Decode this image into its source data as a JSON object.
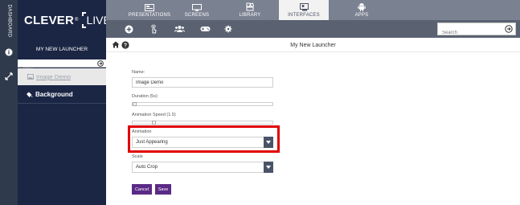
{
  "dashboard": {
    "label": "DASHBOARD"
  },
  "logo": {
    "name": "CLEVER",
    "registered": "®",
    "live": "LIVE"
  },
  "topnav": {
    "tabs": [
      {
        "label": "PRESENTATIONS",
        "icon": "presentation-icon"
      },
      {
        "label": "SCREENS",
        "icon": "monitor-icon"
      },
      {
        "label": "LIBRARY",
        "icon": "library-icon"
      },
      {
        "label": "INTERFACES",
        "icon": "interface-icon",
        "active": true
      },
      {
        "label": "APPS",
        "icon": "android-icon"
      }
    ]
  },
  "toolbar": {
    "icons": [
      "add-icon",
      "touch-icon",
      "users-icon",
      "gamepad-icon",
      "gear-icon"
    ],
    "search_placeholder": "Search"
  },
  "sidebar": {
    "title": "MY NEW LAUNCHER",
    "search_placeholder": "Search",
    "items": [
      {
        "label": "Image Demo",
        "icon": "image-icon"
      },
      {
        "label": "Background",
        "icon": "paint-icon"
      }
    ]
  },
  "content": {
    "title": "My New Launcher",
    "name_label": "Name:",
    "name_value": "Image Demo",
    "duration_label": "Duration (5s)",
    "duration_value": 0.0,
    "anim_speed_label": "Animation Speed (1.5)",
    "anim_speed_value": 0.14,
    "animation_label": "Animation",
    "animation_value": "Just Appearing",
    "scale_label": "Scale",
    "scale_value": "Auto Crop",
    "cancel_label": "Cancel",
    "save_label": "Save"
  },
  "colors": {
    "nav_bg": "#7a8191",
    "toolbar_bg": "#5a6272",
    "sidebar_bg": "#1b2644",
    "button_bg": "#5b2a86",
    "highlight": "#e00000"
  }
}
